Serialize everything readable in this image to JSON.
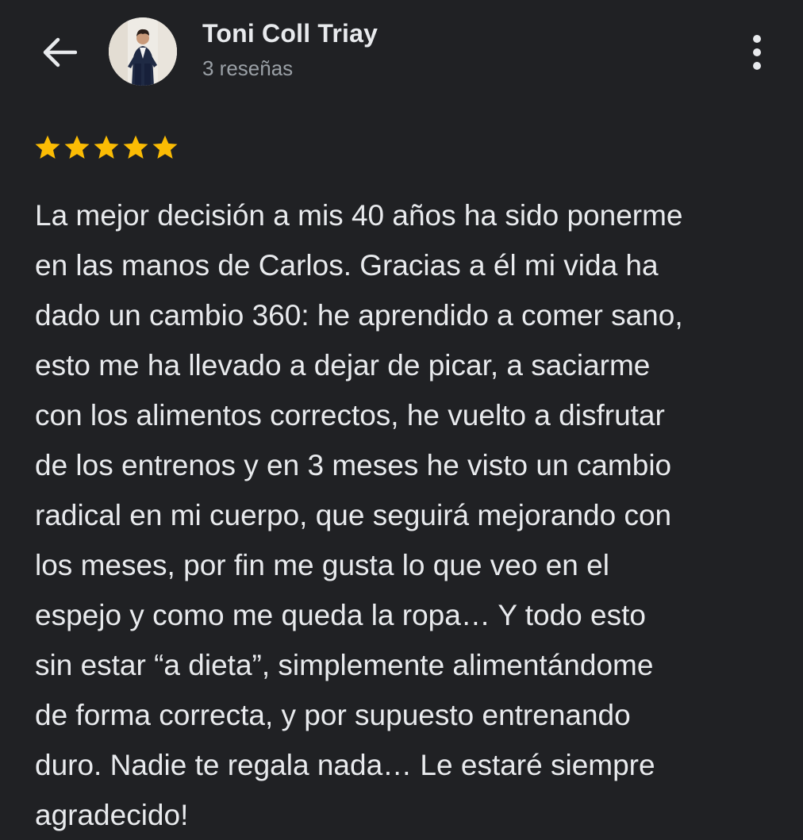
{
  "header": {
    "reviewer_name": "Toni Coll Triay",
    "reviewer_meta": "3 reseñas"
  },
  "icons": {
    "back": "arrow-back-icon",
    "more": "more-vert-icon",
    "star": "star-icon"
  },
  "review": {
    "rating": 5,
    "rating_max": 5,
    "text": "La mejor decisión a mis 40 años ha sido ponerme\nen las manos de Carlos. Gracias a él mi vida ha\ndado un cambio 360: he aprendido a comer sano,\nesto me ha llevado a dejar de picar, a saciarme\ncon los alimentos correctos, he vuelto a disfrutar\nde los entrenos y en 3 meses he visto un cambio\nradical en mi cuerpo, que seguirá mejorando con\nlos meses, por fin me gusta lo que veo en el\nespejo y como me queda la ropa… Y todo esto\nsin estar “a dieta”, simplemente alimentándome\nde forma correcta, y por supuesto entrenando\nduro. Nadie te regala nada… Le estaré siempre\nagradecido!"
  },
  "colors": {
    "background": "#202124",
    "text_primary": "#e8eaed",
    "text_secondary": "#9aa0a6",
    "star": "#fbbc04"
  }
}
